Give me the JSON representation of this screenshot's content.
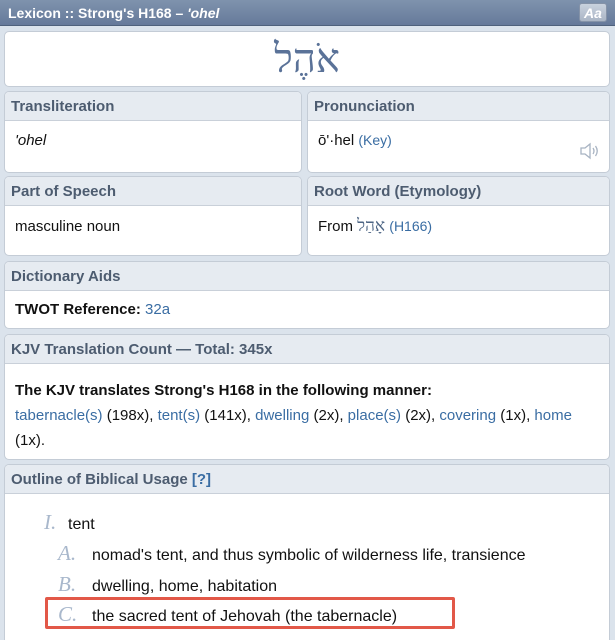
{
  "header": {
    "title": "Lexicon :: Strong's H168 –",
    "translit": "'ohel",
    "font_button": "Aa"
  },
  "word": {
    "hebrew": "אֹהֶל"
  },
  "transliteration": {
    "label": "Transliteration",
    "value": "'ohel"
  },
  "pronunciation": {
    "label": "Pronunciation",
    "value": "ō'·hel",
    "key_link": "(Key)",
    "speaker_icon": "speaker-icon"
  },
  "part_of_speech": {
    "label": "Part of Speech",
    "value": "masculine noun"
  },
  "root_word": {
    "label": "Root Word (Etymology)",
    "prefix": "From",
    "hebrew": "אָהַל",
    "link": "(H166)"
  },
  "dictionary_aids": {
    "label": "Dictionary Aids",
    "twot_label": "TWOT Reference:",
    "twot_value": "32a"
  },
  "kjv": {
    "label": "KJV Translation Count — Total: 345x",
    "intro": "The KJV translates Strong's H168 in the following manner:",
    "items": [
      {
        "word": "tabernacle(s)",
        "count": "(198x),"
      },
      {
        "word": "tent(s)",
        "count": "(141x),"
      },
      {
        "word": "dwelling",
        "count": "(2x),"
      },
      {
        "word": "place(s)",
        "count": "(2x),"
      },
      {
        "word": "covering",
        "count": "(1x),"
      },
      {
        "word": "home",
        "count": "(1x)."
      }
    ]
  },
  "outline": {
    "label": "Outline of Biblical Usage",
    "help": "[?]",
    "items": [
      {
        "marker": "I.",
        "text": "tent"
      },
      {
        "marker": "A.",
        "text": "nomad's tent, and thus symbolic of wilderness life, transience"
      },
      {
        "marker": "B.",
        "text": "dwelling, home, habitation"
      },
      {
        "marker": "C.",
        "text": "the sacred tent of Jehovah (the tabernacle)"
      }
    ]
  },
  "colors": {
    "highlight": "#e25848",
    "link": "#3a6da3",
    "header_bg": "#66799a"
  }
}
